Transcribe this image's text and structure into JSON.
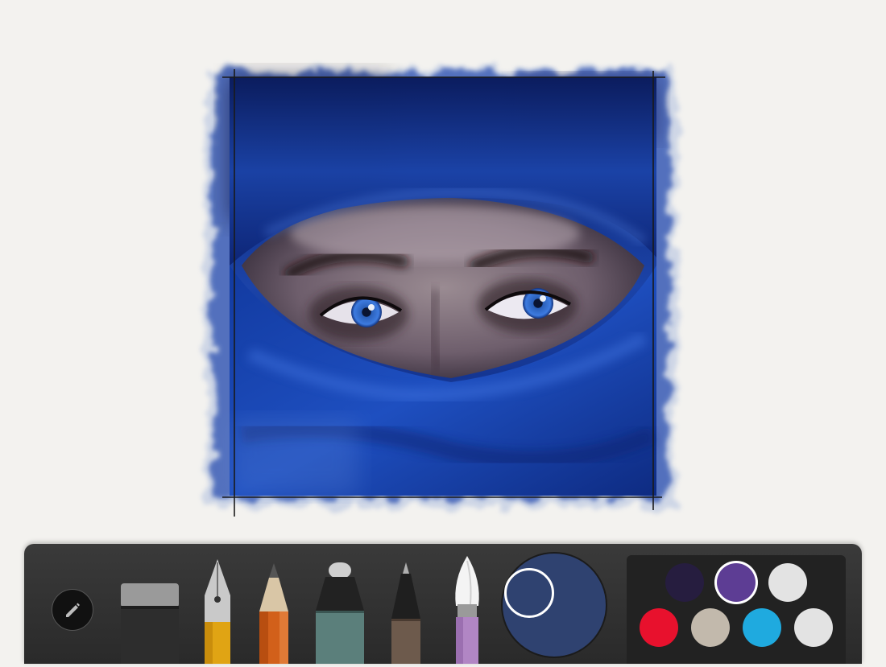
{
  "app": {
    "artwork_name": "blue-veil-eyes-painting",
    "canvas_background": "#f3f2ef"
  },
  "toolbar": {
    "journal_button_icon": "pencil-icon",
    "tools": [
      {
        "name": "eraser",
        "icon": "eraser-icon",
        "color": "#2d2d2d"
      },
      {
        "name": "fountain-pen",
        "icon": "fountain-pen-icon",
        "color": "#e0a414"
      },
      {
        "name": "pencil",
        "icon": "pencil-tool-icon",
        "color": "#d2601a"
      },
      {
        "name": "marker",
        "icon": "marker-icon",
        "color": "#5b7f7b"
      },
      {
        "name": "pen",
        "icon": "pen-icon",
        "color": "#6d5a4c"
      },
      {
        "name": "watercolor-brush",
        "icon": "brush-icon",
        "color": "#b186c4"
      }
    ],
    "current_color": "#2f4270",
    "palette": [
      {
        "hex": "#261d3f",
        "selected": false
      },
      {
        "hex": "#5d3d94",
        "selected": true
      },
      {
        "hex": "#e3e3e3",
        "selected": false
      },
      {
        "hex": "#e8112d",
        "selected": false
      },
      {
        "hex": "#c2b9ac",
        "selected": false
      },
      {
        "hex": "#1faadf",
        "selected": false
      },
      {
        "hex": "#e3e3e3",
        "selected": false
      }
    ]
  }
}
